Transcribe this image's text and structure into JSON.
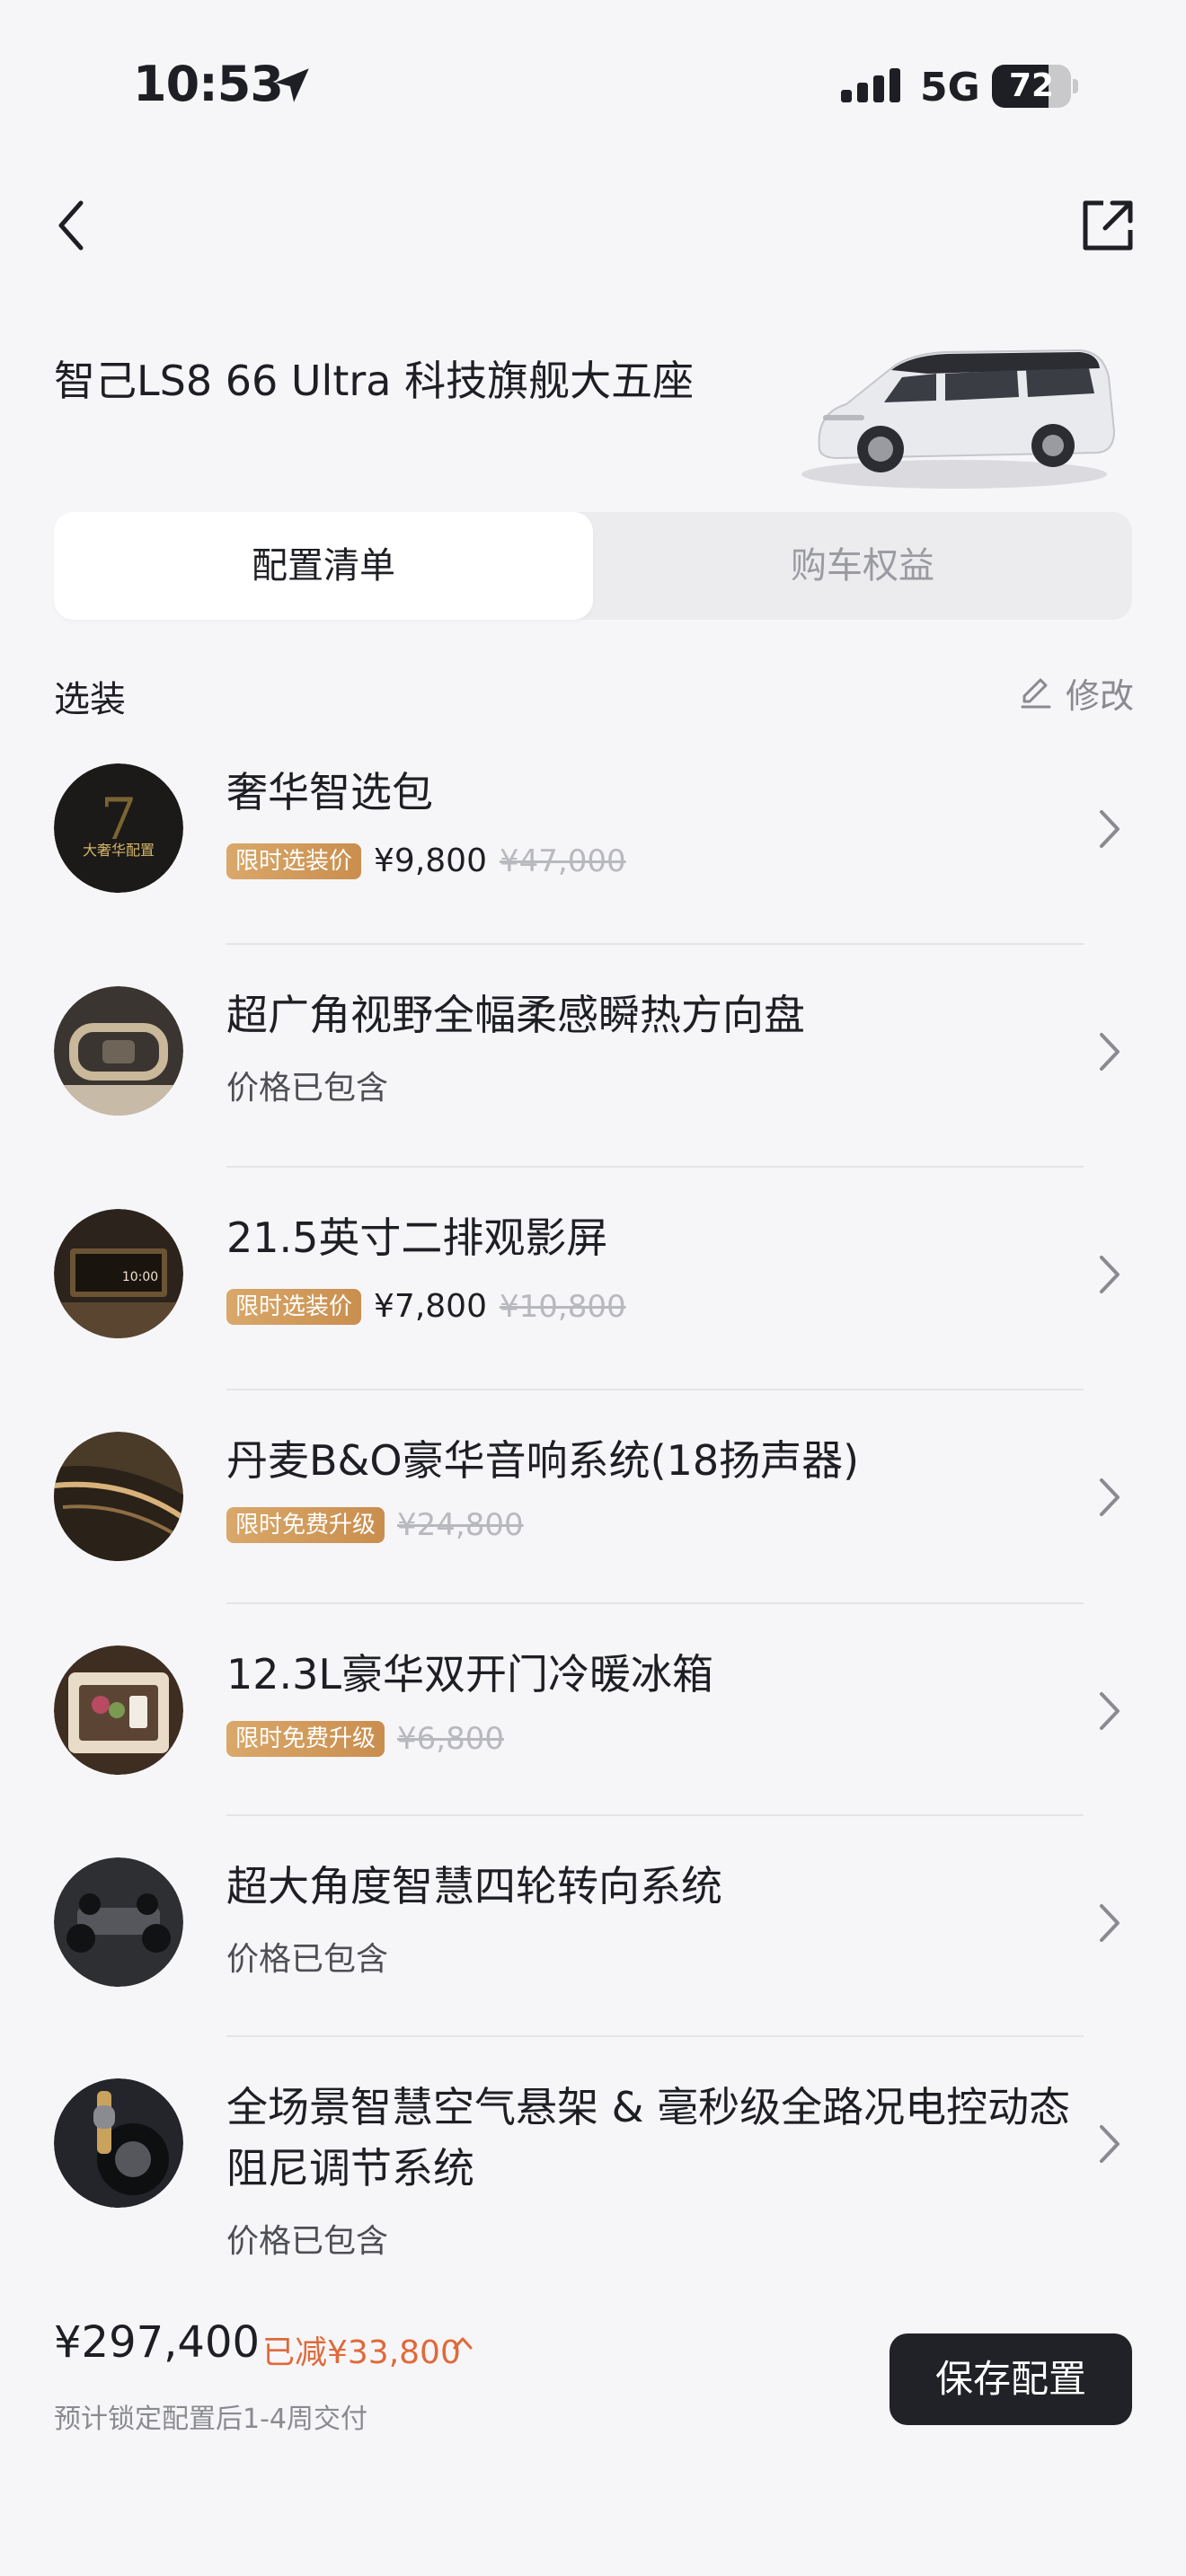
{
  "status_bar": {
    "time": "10:53",
    "network": "5G",
    "battery_percent": "72",
    "battery_level": 0.72
  },
  "header": {
    "car_title": "智己LS8 66 Ultra 科技旗舰大五座"
  },
  "tabs": [
    {
      "label": "配置清单",
      "active": true
    },
    {
      "label": "购车权益",
      "active": false
    }
  ],
  "section": {
    "title": "选装",
    "edit_label": "修改"
  },
  "options": [
    {
      "name": "奢华智选包",
      "tag": "限时选装价",
      "price": "¥9,800",
      "original_price": "¥47,000",
      "included": "",
      "thumb_text": "大奢华配置"
    },
    {
      "name": "超广角视野全幅柔感瞬热方向盘",
      "tag": "",
      "price": "",
      "original_price": "",
      "included": "价格已包含",
      "thumb_text": ""
    },
    {
      "name": "21.5英寸二排观影屏",
      "tag": "限时选装价",
      "price": "¥7,800",
      "original_price": "¥10,800",
      "included": "",
      "thumb_text": "10:00"
    },
    {
      "name": "丹麦B&O豪华音响系统(18扬声器)",
      "tag": "限时免费升级",
      "price": "",
      "original_price": "¥24,800",
      "included": "",
      "thumb_text": ""
    },
    {
      "name": "12.3L豪华双开门冷暖冰箱",
      "tag": "限时免费升级",
      "price": "",
      "original_price": "¥6,800",
      "included": "",
      "thumb_text": ""
    },
    {
      "name": "超大角度智慧四轮转向系统",
      "tag": "",
      "price": "",
      "original_price": "",
      "included": "价格已包含",
      "thumb_text": ""
    },
    {
      "name": "全场景智慧空气悬架 & 毫秒级全路况电控动态阻尼调节系统",
      "tag": "",
      "price": "",
      "original_price": "",
      "included": "价格已包含",
      "thumb_text": ""
    }
  ],
  "footer": {
    "total_price": "¥297,400",
    "discount": "已减¥33,800",
    "delivery_note": "预计锁定配置后1-4周交付",
    "save_label": "保存配置"
  },
  "colors": {
    "background": "#F6F6F8",
    "accent_discount": "#E0693A",
    "promo_tag": "#D1995A",
    "button_dark": "#202227"
  }
}
